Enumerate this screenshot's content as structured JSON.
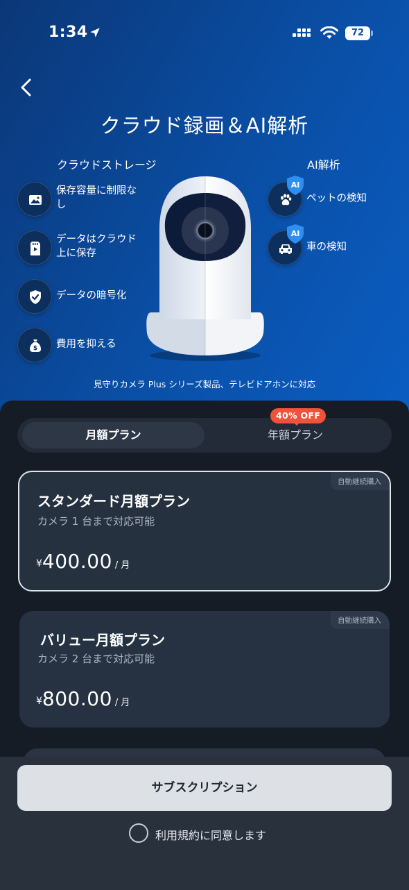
{
  "status_bar": {
    "time": "1:34",
    "battery": "72"
  },
  "header": {
    "title": "クラウド録画＆AI解析"
  },
  "storage": {
    "title": "クラウドストレージ",
    "features": [
      {
        "label": "保存容量に制限なし",
        "icon": "image-icon"
      },
      {
        "label": "データはクラウド上に保存",
        "icon": "sd-card-icon"
      },
      {
        "label": "データの暗号化",
        "icon": "shield-check-icon"
      },
      {
        "label": "費用を抑える",
        "icon": "money-bag-icon"
      }
    ]
  },
  "ai": {
    "title": "AI解析",
    "badge": "AI",
    "features": [
      {
        "label": "ペットの検知",
        "icon": "paw-icon"
      },
      {
        "label": "車の検知",
        "icon": "car-icon"
      }
    ]
  },
  "hero_note": "見守りカメラ Plus シリーズ製品、テレビドアホンに対応",
  "plan_tabs": {
    "monthly": "月額プラン",
    "yearly": "年額プラン",
    "discount_badge": "40% OFF",
    "selected": "monthly"
  },
  "plans": [
    {
      "tag": "自動継続購入",
      "name": "スタンダード月額プラン",
      "desc": "カメラ 1 台まで対応可能",
      "currency": "¥",
      "price": "400.00",
      "unit": "/ 月",
      "selected": true
    },
    {
      "tag": "自動継続購入",
      "name": "バリュー月額プラン",
      "desc": "カメラ 2 台まで対応可能",
      "currency": "¥",
      "price": "800.00",
      "unit": "/ 月",
      "selected": false
    }
  ],
  "footer": {
    "subscribe_label": "サブスクリプション",
    "agree_label": "利用規約に同意します"
  },
  "colors": {
    "hero_start": "#0b3777",
    "hero_end": "#0a5dc2",
    "badge_red": "#f0523a",
    "sheet_bg": "#161c25"
  }
}
